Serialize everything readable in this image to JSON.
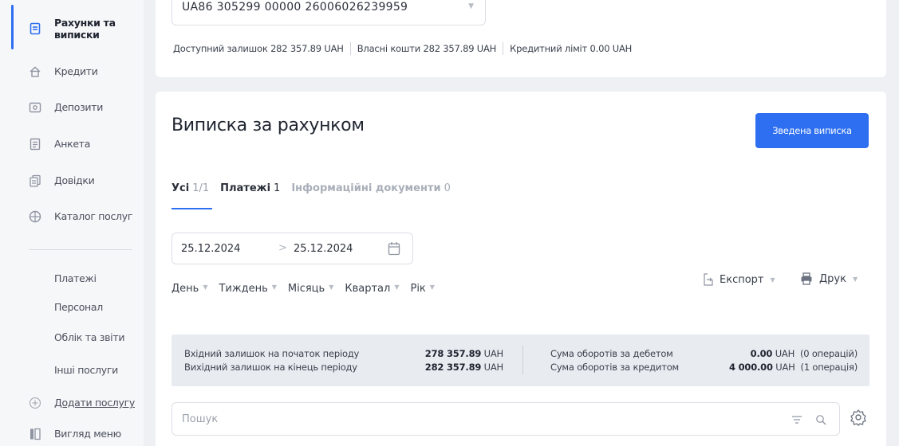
{
  "sidebar": {
    "items": [
      {
        "label": "Рахунки та виписки",
        "icon": "document-icon",
        "active": true
      },
      {
        "label": "Кредити",
        "icon": "home-icon"
      },
      {
        "label": "Депозити",
        "icon": "deposit-icon"
      },
      {
        "label": "Анкета",
        "icon": "form-icon"
      },
      {
        "label": "Довідки",
        "icon": "certificates-icon"
      },
      {
        "label": "Каталог послуг",
        "icon": "globe-icon"
      }
    ],
    "sub_items": [
      {
        "label": "Платежі"
      },
      {
        "label": "Персонал"
      },
      {
        "label": "Облік та звіти"
      },
      {
        "label": "Інші послуги"
      }
    ],
    "add_service": "Додати послугу",
    "menu_view": "Вигляд меню"
  },
  "account": {
    "iban": "UA86 305299 00000 26006026239959",
    "available_label": "Доступний залишок",
    "available_value": "282 357.89",
    "own_label": "Власні кошти",
    "own_value": "282 357.89",
    "credit_label": "Кредитний ліміт",
    "credit_value": "0.00",
    "currency": "UAH"
  },
  "statement": {
    "title": "Виписка за рахунком",
    "summary_button": "Зведена виписка",
    "tabs": [
      {
        "label": "Усі",
        "count": "1/1"
      },
      {
        "label": "Платежі",
        "count": "1"
      },
      {
        "label": "Інформаційні документи",
        "count": "0"
      }
    ],
    "date_from": "25.12.2024",
    "date_to": "25.12.2024",
    "periods": [
      "День",
      "Тиждень",
      "Місяць",
      "Квартал",
      "Рік"
    ],
    "export_label": "Експорт",
    "print_label": "Друк",
    "summary": {
      "opening_label": "Вхідний залишок на початок періоду",
      "opening_value": "278 357.89",
      "closing_label": "Вихідний залишок на кінець періоду",
      "closing_value": "282 357.89",
      "debit_label": "Сума оборотів за дебетом",
      "debit_value": "0.00",
      "debit_ops": "(0 операцій)",
      "credit_label": "Сума оборотів за кредитом",
      "credit_value": "4 000.00",
      "credit_ops": "(1 операція)",
      "currency": "UAH"
    },
    "search_placeholder": "Пошук"
  },
  "colors": {
    "accent": "#2d6ff0",
    "summary_bg": "#e8ebf0"
  }
}
